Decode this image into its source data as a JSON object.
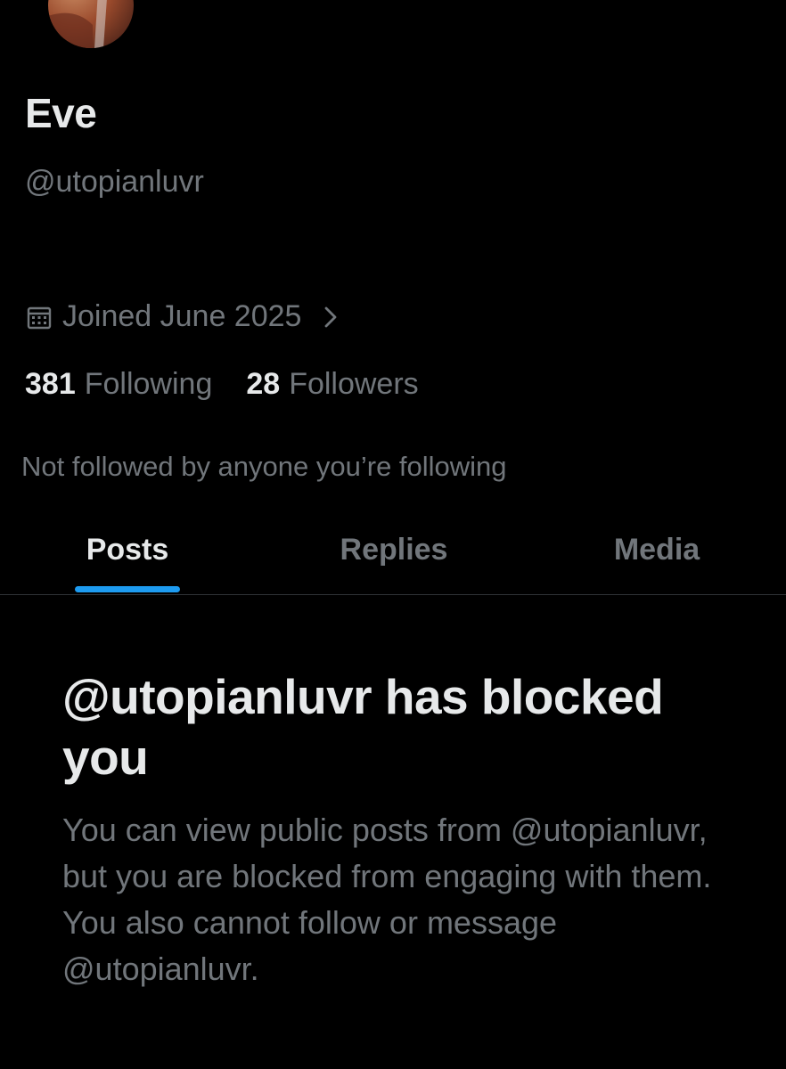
{
  "profile": {
    "display_name": "Eve",
    "handle": "@utopianluvr",
    "joined": "Joined June 2025",
    "following_count": "381",
    "following_label": "Following",
    "followers_count": "28",
    "followers_label": "Followers",
    "not_followed_text": "Not followed by anyone you’re following"
  },
  "tabs": [
    {
      "label": "Posts",
      "active": true
    },
    {
      "label": "Replies",
      "active": false
    },
    {
      "label": "Media",
      "active": false
    }
  ],
  "blocked_notice": {
    "title": "@utopianluvr has blocked you",
    "body": "You can view public posts from @utopianluvr, but you are blocked from engaging with them. You also cannot follow or message @utopianluvr."
  },
  "colors": {
    "background": "#000000",
    "primary_text": "#e7e9ea",
    "secondary_text": "#71767b",
    "accent": "#1d9bf0",
    "divider": "#2f3336"
  },
  "icons": {
    "joined": "calendar-icon",
    "joined_link": "chevron-right-icon"
  }
}
